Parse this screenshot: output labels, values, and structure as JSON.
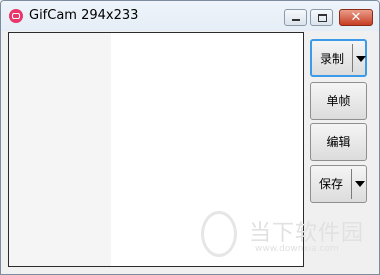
{
  "window": {
    "title": "GifCam 294x233",
    "close_glyph": "✕",
    "icon": "gifcam-app-icon"
  },
  "buttons": {
    "record": "录制",
    "single_frame": "单帧",
    "edit": "编辑",
    "save": "保存"
  },
  "watermark": {
    "title": "当下软件园",
    "url": "www.downxia.com"
  },
  "colors": {
    "close_button": "#c63d23",
    "focus_border": "#3c9ae8",
    "app_icon": "#e8376a"
  }
}
